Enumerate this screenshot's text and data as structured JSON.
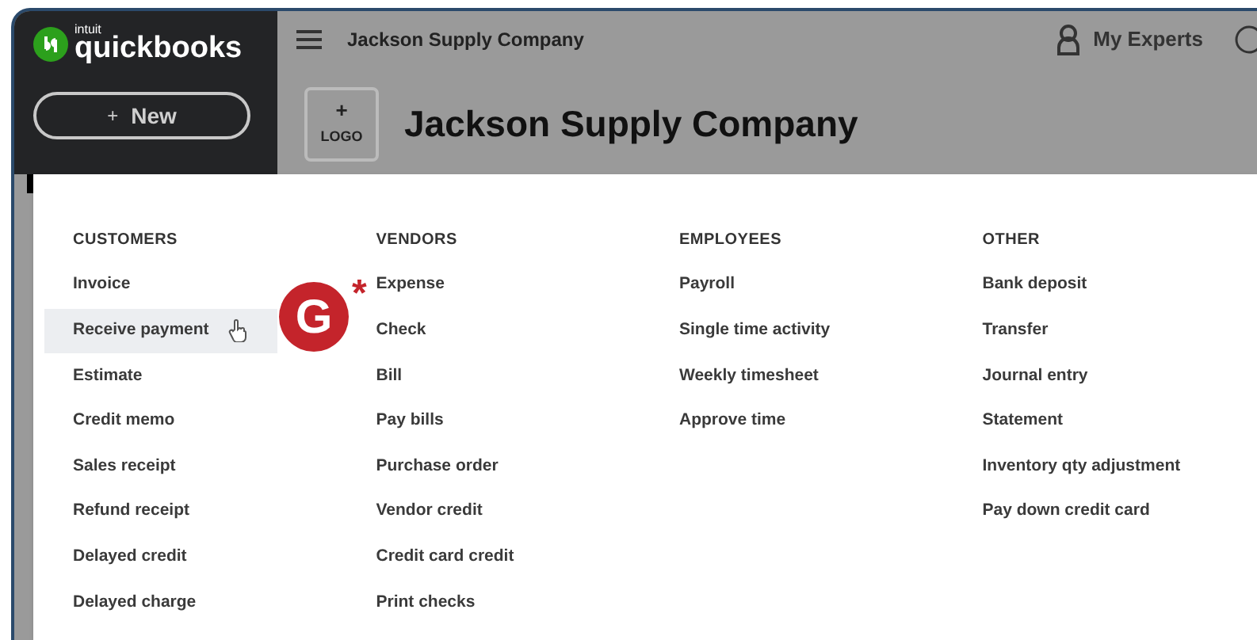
{
  "brand": {
    "small": "intuit",
    "name": "quickbooks"
  },
  "sidebar": {
    "new_button": {
      "icon": "+",
      "label": "New"
    }
  },
  "header": {
    "company": "Jackson Supply Company",
    "experts": "My Experts"
  },
  "company_banner": {
    "logo_plus": "+",
    "logo_label": "LOGO",
    "title": "Jackson Supply Company"
  },
  "new_menu": {
    "columns": [
      {
        "heading": "CUSTOMERS",
        "items": [
          {
            "label": "Invoice",
            "selected": false
          },
          {
            "label": "Receive payment",
            "selected": true
          },
          {
            "label": "Estimate",
            "selected": false
          },
          {
            "label": "Credit memo",
            "selected": false
          },
          {
            "label": "Sales receipt",
            "selected": false
          },
          {
            "label": "Refund receipt",
            "selected": false
          },
          {
            "label": "Delayed credit",
            "selected": false
          },
          {
            "label": "Delayed charge",
            "selected": false
          }
        ]
      },
      {
        "heading": "VENDORS",
        "items": [
          {
            "label": "Expense",
            "selected": false
          },
          {
            "label": "Check",
            "selected": false
          },
          {
            "label": "Bill",
            "selected": false
          },
          {
            "label": "Pay bills",
            "selected": false
          },
          {
            "label": "Purchase order",
            "selected": false
          },
          {
            "label": "Vendor credit",
            "selected": false
          },
          {
            "label": "Credit card credit",
            "selected": false
          },
          {
            "label": "Print checks",
            "selected": false
          }
        ]
      },
      {
        "heading": "EMPLOYEES",
        "items": [
          {
            "label": "Payroll",
            "selected": false
          },
          {
            "label": "Single time activity",
            "selected": false
          },
          {
            "label": "Weekly timesheet",
            "selected": false
          },
          {
            "label": "Approve time",
            "selected": false
          }
        ]
      },
      {
        "heading": "OTHER",
        "items": [
          {
            "label": "Bank deposit",
            "selected": false
          },
          {
            "label": "Transfer",
            "selected": false
          },
          {
            "label": "Journal entry",
            "selected": false
          },
          {
            "label": "Statement",
            "selected": false
          },
          {
            "label": "Inventory qty adjustment",
            "selected": false
          },
          {
            "label": "Pay down credit card",
            "selected": false
          }
        ]
      }
    ]
  },
  "annotation": {
    "letter": "G",
    "mark": "*"
  }
}
